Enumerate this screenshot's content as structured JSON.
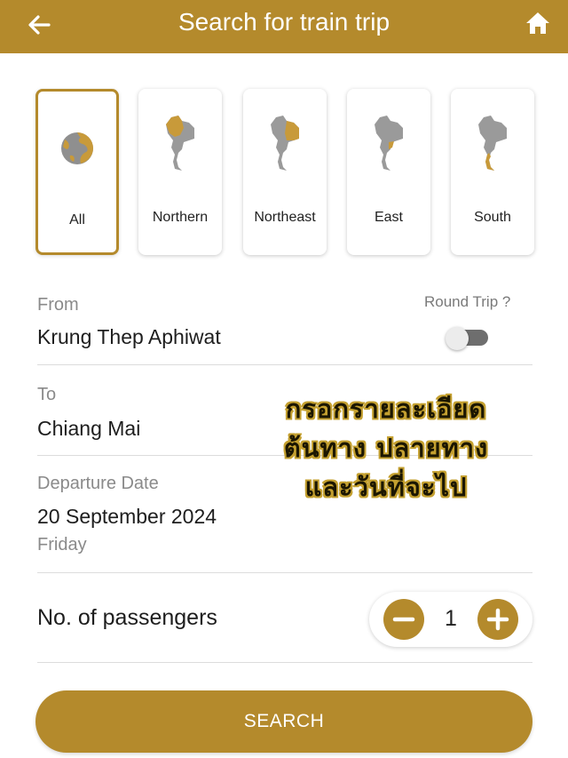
{
  "header": {
    "title": "Search for train trip",
    "back_icon": "arrow-left-icon",
    "home_icon": "home-icon",
    "color": "#b48a2c"
  },
  "regions": {
    "selected": "All",
    "items": [
      {
        "label": "All",
        "icon": "globe-icon"
      },
      {
        "label": "Northern",
        "icon": "thailand-map-northern-icon"
      },
      {
        "label": "Northeast",
        "icon": "thailand-map-northeast-icon"
      },
      {
        "label": "East",
        "icon": "thailand-map-east-icon"
      },
      {
        "label": "South",
        "icon": "thailand-map-south-icon"
      }
    ]
  },
  "from": {
    "label": "From",
    "value": "Krung Thep Aphiwat"
  },
  "round_trip": {
    "label": "Round Trip ?",
    "enabled": false
  },
  "to": {
    "label": "To",
    "value": "Chiang Mai"
  },
  "departure": {
    "label": "Departure Date",
    "date": "20 September 2024",
    "weekday": "Friday"
  },
  "overlay": {
    "line1": "กรอกรายละเอียด",
    "line2": "ต้นทาง ปลายทาง",
    "line3": "และวันที่จะไป"
  },
  "passengers": {
    "label": "No. of passengers",
    "count": "1",
    "minus_icon": "minus-icon",
    "plus_icon": "plus-icon"
  },
  "search": {
    "label": "SEARCH"
  }
}
